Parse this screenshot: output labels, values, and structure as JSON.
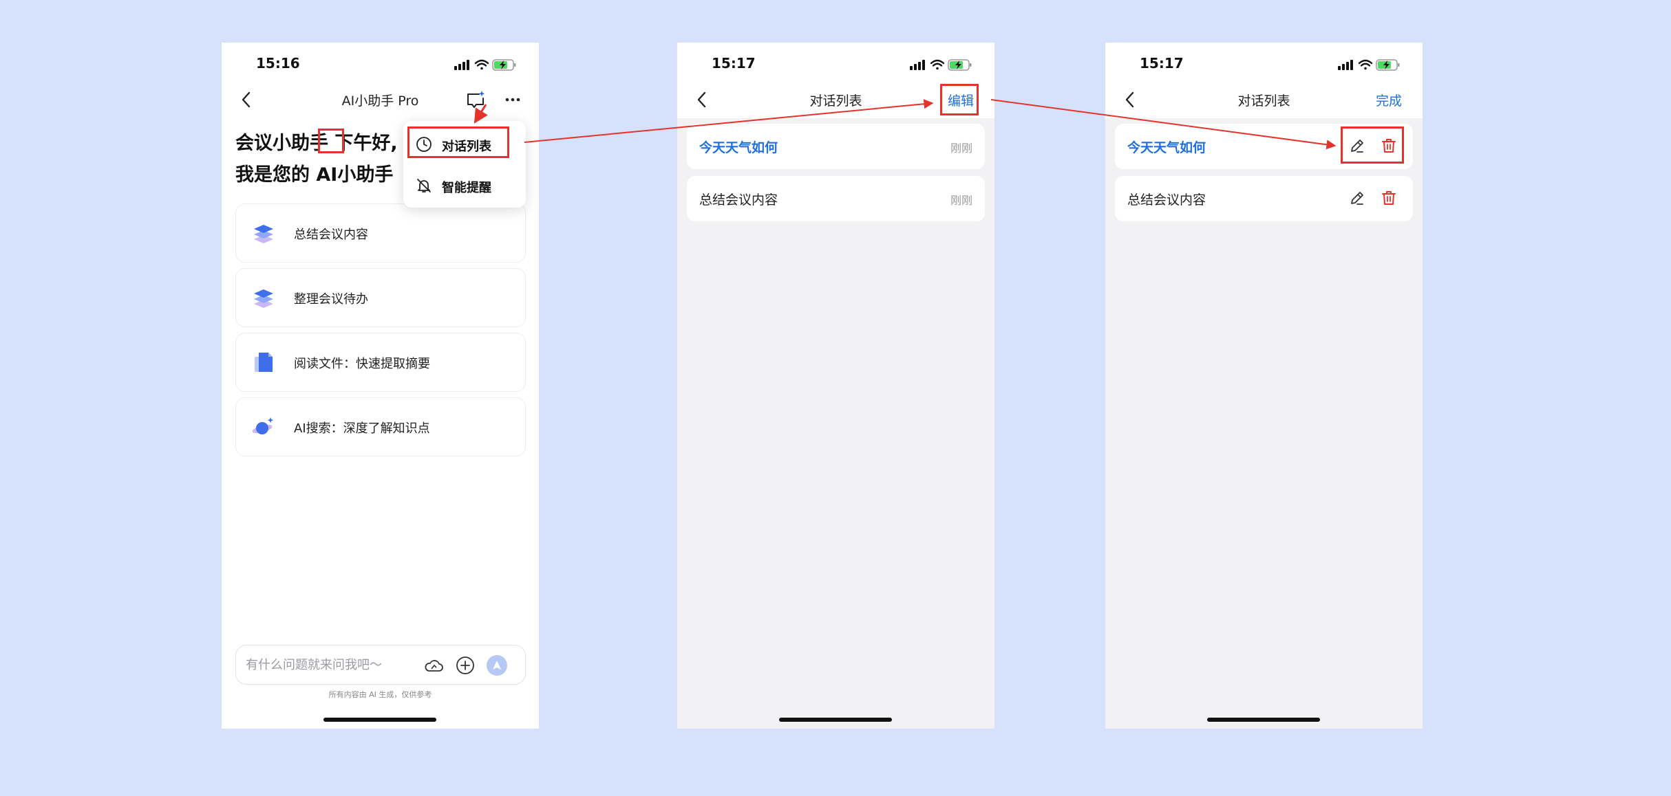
{
  "colors": {
    "background": "#d6e2fb",
    "accent": "#1f6fe0",
    "danger": "#e5322b"
  },
  "screen1": {
    "time": "15:16",
    "nav_title": "AI小助手 Pro",
    "greeting_line1": "会议小助手 下午好,",
    "greeting_line2": "我是您的 AI小助手",
    "suggestions": [
      {
        "label": "总结会议内容",
        "icon": "layers-icon"
      },
      {
        "label": "整理会议待办",
        "icon": "layers-icon"
      },
      {
        "label": "阅读文件：快速提取摘要",
        "icon": "document-icon"
      },
      {
        "label": "AI搜索：深度了解知识点",
        "icon": "planet-icon"
      }
    ],
    "menu": [
      {
        "label": "对话列表",
        "icon": "clock-icon"
      },
      {
        "label": "智能提醒",
        "icon": "bell-off-icon"
      }
    ],
    "input_placeholder": "有什么问题就来问我吧～",
    "footnote": "所有内容由 AI 生成，仅供参考"
  },
  "screen2": {
    "time": "15:17",
    "nav_title": "对话列表",
    "nav_action": "编辑",
    "items": [
      {
        "title": "今天天气如何",
        "time": "刚刚"
      },
      {
        "title": "总结会议内容",
        "time": "刚刚"
      }
    ]
  },
  "screen3": {
    "time": "15:17",
    "nav_title": "对话列表",
    "nav_action": "完成",
    "items": [
      {
        "title": "今天天气如何"
      },
      {
        "title": "总结会议内容"
      }
    ]
  }
}
